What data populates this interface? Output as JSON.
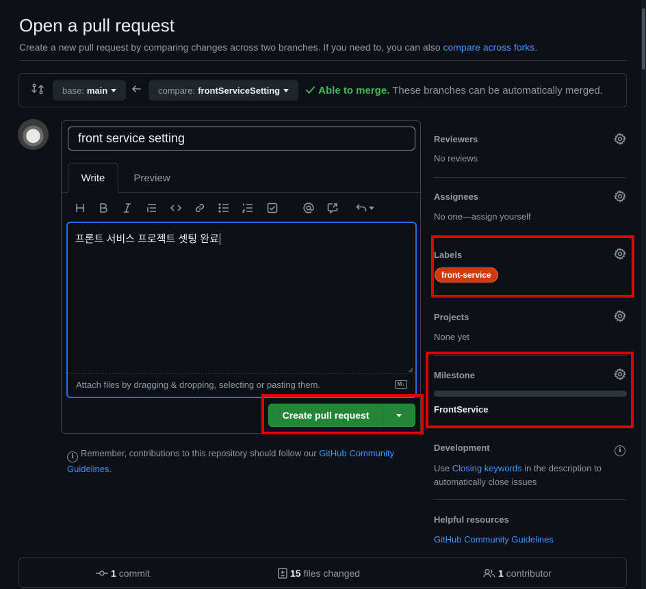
{
  "header": {
    "title": "Open a pull request",
    "subtitle": "Create a new pull request by comparing changes across two branches. If you need to, you can also ",
    "subtitle_link": "compare across forks",
    "subtitle_end": "."
  },
  "range": {
    "base_prefix": "base:",
    "base_branch": "main",
    "compare_prefix": "compare:",
    "compare_branch": "frontServiceSetting",
    "merge_ok": "Able to merge.",
    "merge_text": "These branches can be automatically merged."
  },
  "editor": {
    "title_value": "front service setting",
    "tab_write": "Write",
    "tab_preview": "Preview",
    "body": "프론트 서비스 프로젝트 셋팅 완료",
    "attach": "Attach files by dragging & dropping, selecting or pasting them.",
    "md_badge": "M↓",
    "create_label": "Create pull request"
  },
  "notice": {
    "text": "Remember, contributions to this repository should follow our ",
    "link": "GitHub Community Guidelines",
    "end": "."
  },
  "sidebar": {
    "reviewers": {
      "title": "Reviewers",
      "value": "No reviews"
    },
    "assignees": {
      "title": "Assignees",
      "value": "No one—assign yourself"
    },
    "labels": {
      "title": "Labels",
      "label": "front-service",
      "label_color": "#d33a0a"
    },
    "projects": {
      "title": "Projects",
      "value": "None yet"
    },
    "milestone": {
      "title": "Milestone",
      "name": "FrontService",
      "progress": 0
    },
    "development": {
      "title": "Development",
      "text_start": "Use ",
      "link": "Closing keywords",
      "text_end": " in the description to automatically close issues"
    },
    "helpful": {
      "title": "Helpful resources",
      "link": "GitHub Community Guidelines"
    }
  },
  "stats": {
    "commits_count": "1",
    "commits_label": "commit",
    "files_count": "15",
    "files_label": "files changed",
    "contributors_count": "1",
    "contributors_label": "contributor"
  },
  "colors": {
    "accent": "#4493f8",
    "success": "#238636",
    "highlight": "#e50000"
  }
}
